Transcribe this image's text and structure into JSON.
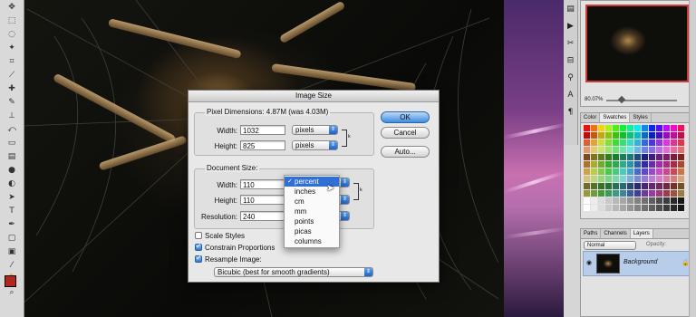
{
  "dialog": {
    "title": "Image Size",
    "pixel_dimensions": {
      "header": "Pixel Dimensions:  4.87M (was 4.03M)",
      "width_label": "Width:",
      "width_value": "1032",
      "width_unit": "pixels",
      "height_label": "Height:",
      "height_value": "825",
      "height_unit": "pixels"
    },
    "document_size": {
      "header": "Document Size:",
      "width_label": "Width:",
      "width_value": "110",
      "height_label": "Height:",
      "height_value": "110",
      "resolution_label": "Resolution:",
      "resolution_value": "240"
    },
    "unit_menu": {
      "options": [
        "percent",
        "inches",
        "cm",
        "mm",
        "points",
        "picas",
        "columns"
      ],
      "selected": "percent"
    },
    "buttons": {
      "ok": "OK",
      "cancel": "Cancel",
      "auto": "Auto..."
    },
    "options": {
      "scale_styles": {
        "label": "Scale Styles",
        "checked": false
      },
      "constrain_proportions": {
        "label": "Constrain Proportions",
        "checked": true
      },
      "resample_image": {
        "label": "Resample Image:",
        "checked": true
      }
    },
    "resample_method": "Bicubic (best for smooth gradients)"
  },
  "navigator": {
    "zoom": "80.07%"
  },
  "swatches_panel": {
    "tabs": [
      "Color",
      "Swatches",
      "Styles"
    ],
    "active_tab": "Swatches"
  },
  "layers_panel": {
    "tabs": [
      "Paths",
      "Channels",
      "Layers"
    ],
    "active_tab": "Layers",
    "blend_mode": "Normal",
    "opacity_label": "Opacity:",
    "layer_name": "Background"
  },
  "colors": {
    "foreground": "#b3261e",
    "background": "#ffffff",
    "accent": "#2f6fd6"
  }
}
